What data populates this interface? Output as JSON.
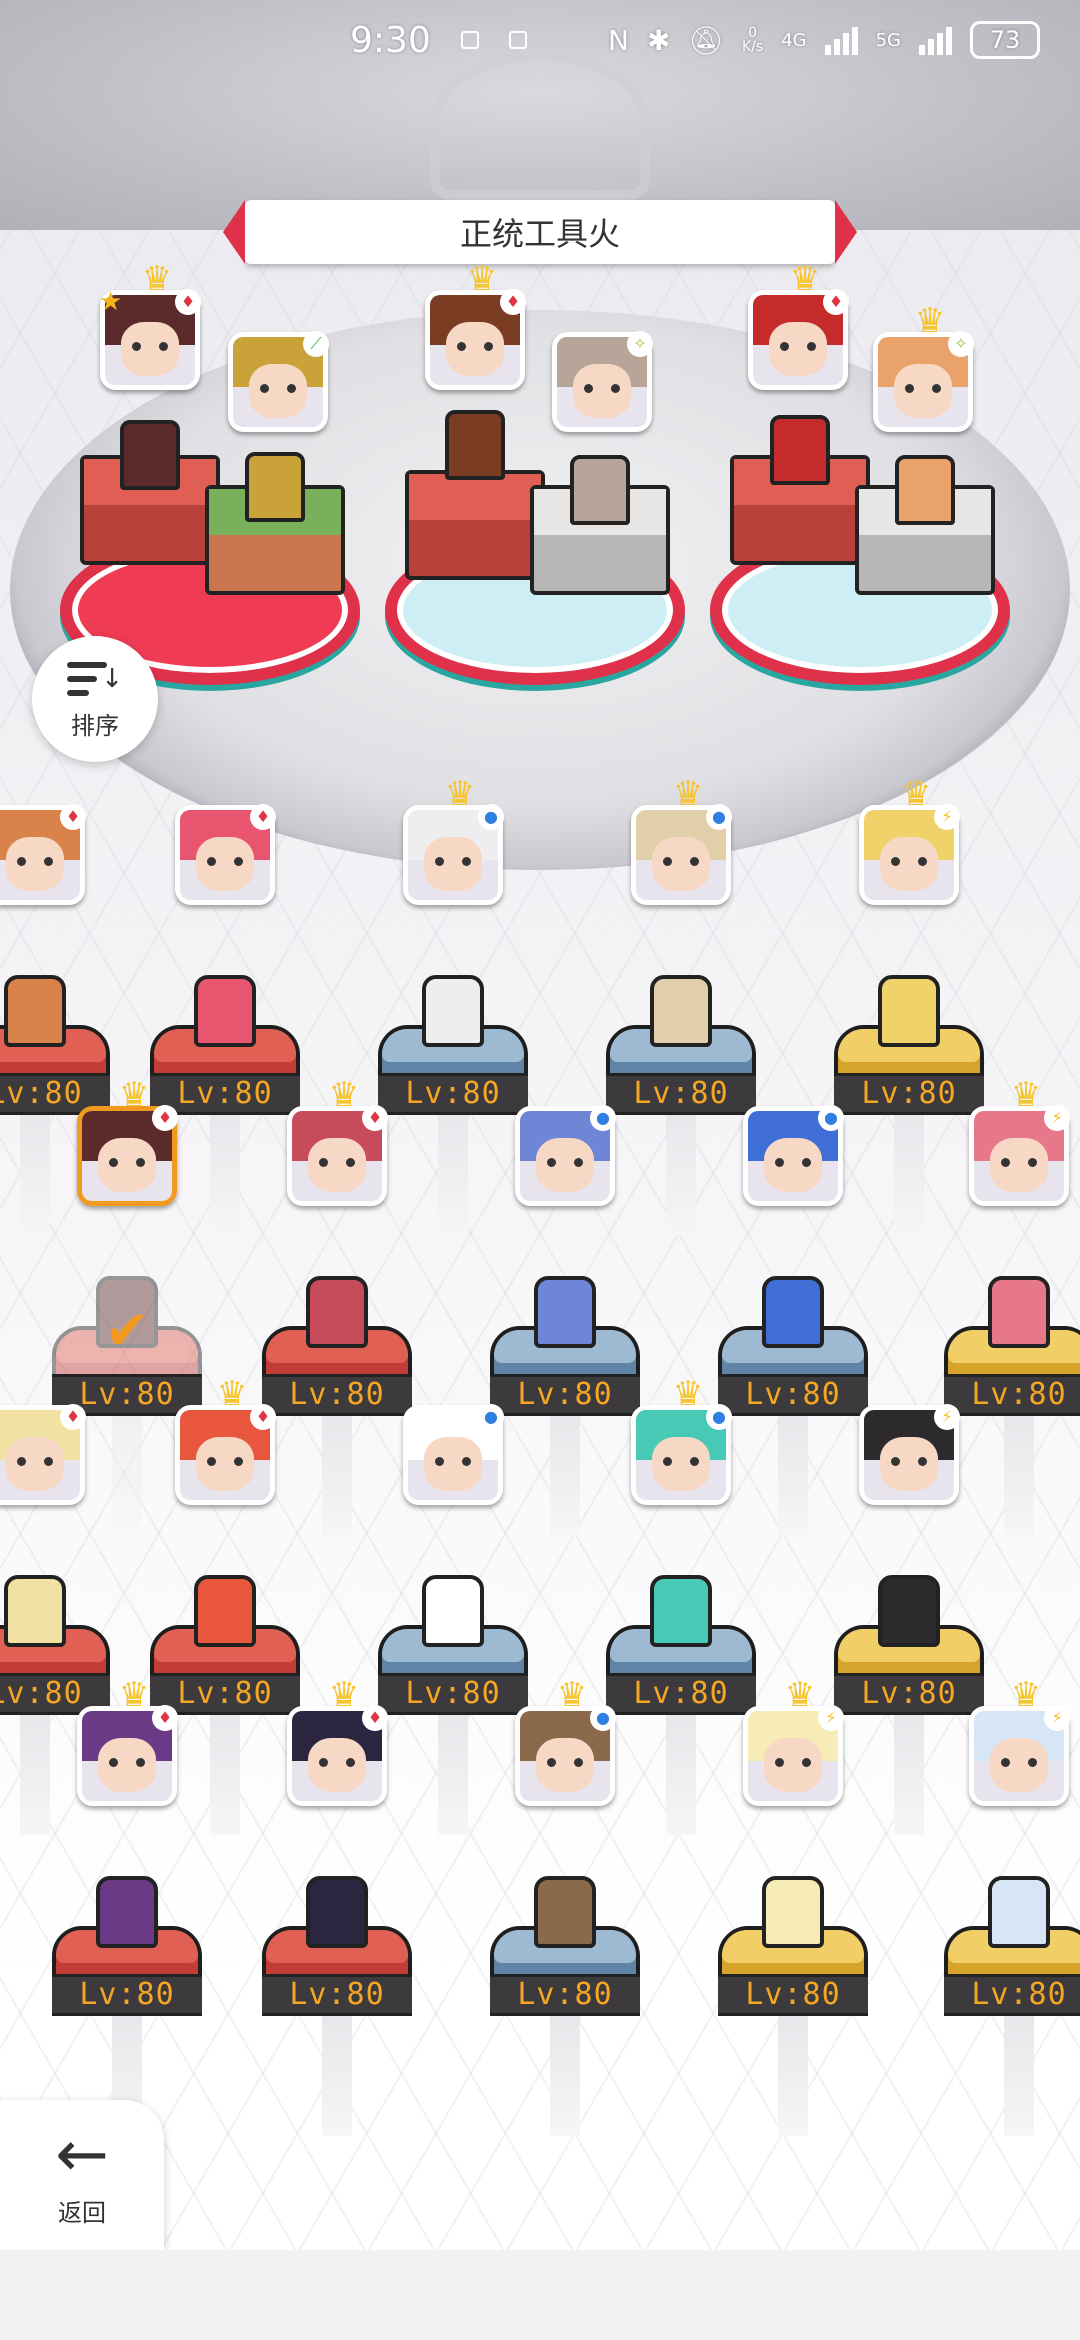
{
  "status_bar": {
    "time": "9:30",
    "network_speed": "0\nK/s",
    "network_4g": "4G",
    "network_5g": "5G",
    "battery": "73"
  },
  "banner": {
    "title": "正统工具火"
  },
  "controls": {
    "sort_label": "排序",
    "back_label": "返回"
  },
  "team": [
    {
      "element": "fire",
      "hair": "#5b2a2a",
      "stand": "red",
      "leader": true,
      "starred": true
    },
    {
      "element": "wind",
      "hair": "#c9a23a",
      "stand": "green",
      "leader": false,
      "starred": false
    },
    {
      "element": "fire",
      "hair": "#7a3c23",
      "stand": "red",
      "leader": true,
      "starred": false
    },
    {
      "element": "light",
      "hair": "#b8a59a",
      "stand": "gray",
      "leader": false,
      "starred": false
    },
    {
      "element": "fire",
      "hair": "#c62b2b",
      "stand": "red",
      "leader": true,
      "starred": false
    },
    {
      "element": "light",
      "hair": "#e9a36a",
      "stand": "gray",
      "leader": true,
      "starred": false
    }
  ],
  "roster": {
    "level_text": "Lv:80",
    "rows": [
      [
        {
          "element": "fire",
          "hair": "#d9824a",
          "stand": "red",
          "leader": false
        },
        {
          "element": "fire",
          "hair": "#e8556e",
          "stand": "red",
          "leader": false
        },
        {
          "element": "water",
          "hair": "#eeeeee",
          "stand": "blue",
          "leader": true
        },
        {
          "element": "water",
          "hair": "#e0cfa8",
          "stand": "blue",
          "leader": true
        },
        {
          "element": "bolt",
          "hair": "#f0d26a",
          "stand": "gold",
          "leader": true
        }
      ],
      [
        {
          "element": "fire",
          "hair": "#5b2a2a",
          "stand": "red",
          "leader": true,
          "selected": true
        },
        {
          "element": "fire",
          "hair": "#c84b5c",
          "stand": "red",
          "leader": true
        },
        {
          "element": "water",
          "hair": "#6f85d6",
          "stand": "blue",
          "leader": false
        },
        {
          "element": "water",
          "hair": "#3f6fd6",
          "stand": "blue",
          "leader": false
        },
        {
          "element": "bolt",
          "hair": "#e7788a",
          "stand": "gold",
          "leader": true
        }
      ],
      [
        {
          "element": "fire",
          "hair": "#f1e1a3",
          "stand": "red",
          "leader": false
        },
        {
          "element": "fire",
          "hair": "#e8573d",
          "stand": "red",
          "leader": true
        },
        {
          "element": "water",
          "hair": "#ffffff",
          "stand": "blue",
          "leader": false
        },
        {
          "element": "water",
          "hair": "#48c9b5",
          "stand": "blue",
          "leader": true
        },
        {
          "element": "bolt",
          "hair": "#2c2a2c",
          "stand": "gold",
          "leader": false
        }
      ],
      [
        {
          "element": "fire",
          "hair": "#6a3a86",
          "stand": "red",
          "leader": true
        },
        {
          "element": "fire",
          "hair": "#2c2540",
          "stand": "red",
          "leader": true
        },
        {
          "element": "water",
          "hair": "#8a6a4a",
          "stand": "blue",
          "leader": true
        },
        {
          "element": "bolt",
          "hair": "#f7ecb6",
          "stand": "gold",
          "leader": true
        },
        {
          "element": "bolt",
          "hair": "#d7e6f7",
          "stand": "gold",
          "leader": true
        }
      ]
    ]
  },
  "colors": {
    "accent": "#e0314a",
    "level_text": "#f5a623",
    "selected": "#f29a1f"
  }
}
